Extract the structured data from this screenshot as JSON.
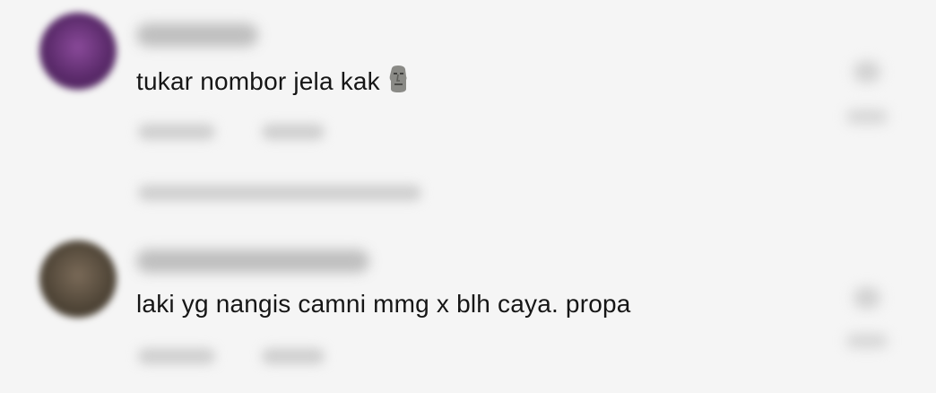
{
  "comments": [
    {
      "text": "tukar nombor jela kak",
      "emoji_icon": "moai-icon"
    },
    {
      "text": "laki yg nangis camni mmg x blh caya. propa"
    }
  ]
}
